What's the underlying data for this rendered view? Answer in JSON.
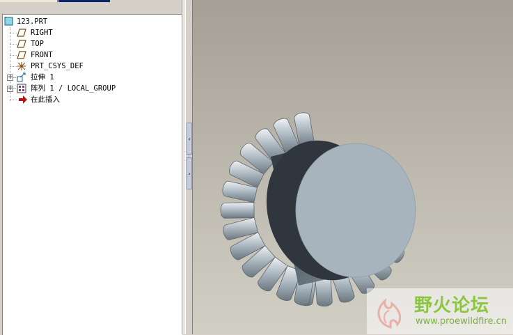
{
  "model_tree": {
    "root": "123.PRT",
    "items": [
      {
        "label": "RIGHT",
        "icon": "datum-plane-icon"
      },
      {
        "label": "TOP",
        "icon": "datum-plane-icon"
      },
      {
        "label": "FRONT",
        "icon": "datum-plane-icon"
      },
      {
        "label": "PRT_CSYS_DEF",
        "icon": "coordinate-system-icon"
      },
      {
        "label": "拉伸 1",
        "icon": "extrude-icon"
      },
      {
        "label": "阵列 1 / LOCAL_GROUP",
        "icon": "pattern-icon"
      },
      {
        "label": "在此插入",
        "icon": "insert-here-arrow-icon"
      }
    ]
  },
  "splitter": {
    "collapse_glyph": "‹",
    "expand_glyph": "›"
  },
  "watermark": {
    "title": "野火论坛",
    "url": "www.proewildfire.cn"
  },
  "colors": {
    "viewport_top": "#a59f95",
    "viewport_bottom": "#d2cfc5",
    "model_face": "#a8b4bd",
    "watermark_green": "#8cc640"
  }
}
